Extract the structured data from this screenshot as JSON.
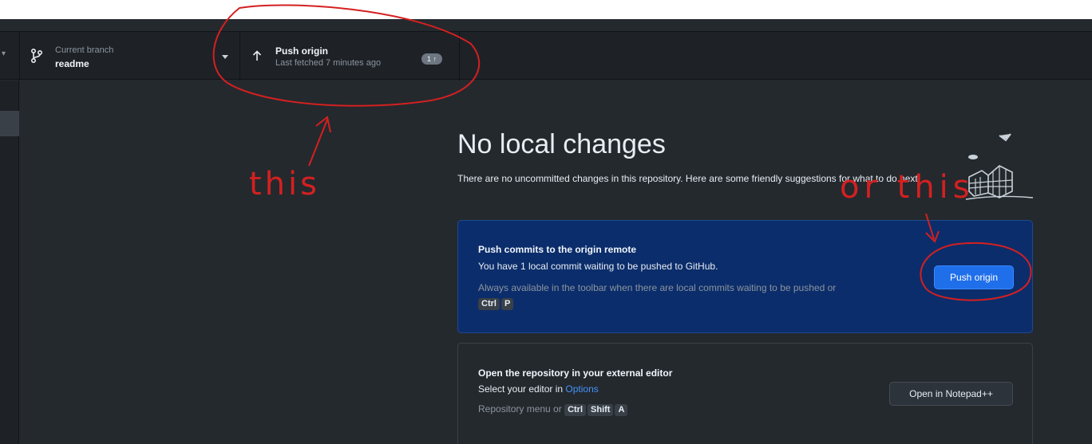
{
  "toolbar": {
    "branch_caption": "Current branch",
    "branch_name": "readme",
    "push_title": "Push origin",
    "push_subtitle": "Last fetched 7 minutes ago",
    "push_badge": "1 ↑"
  },
  "main": {
    "heading": "No local changes",
    "intro": "There are no uncommitted changes in this repository. Here are some friendly suggestions for what to do next.",
    "push_card": {
      "title": "Push commits to the origin remote",
      "description": "You have 1 local commit waiting to be pushed to GitHub.",
      "hint": "Always available in the toolbar when there are local commits waiting to be pushed or",
      "shortcut_keys": [
        "Ctrl",
        "P"
      ],
      "button_label": "Push origin"
    },
    "editor_card": {
      "title": "Open the repository in your external editor",
      "description_prefix": "Select your editor in",
      "description_link": "Options",
      "hint": "Repository menu or",
      "shortcut_keys": [
        "Ctrl",
        "Shift",
        "A"
      ],
      "button_label": "Open in Notepad++"
    }
  },
  "annotations": {
    "label_one": "this",
    "label_two": "or this",
    "color": "#d42020"
  },
  "colors": {
    "app_background": "#24292e",
    "toolbar_background": "#1e2227",
    "accent_blue": "#1f6feb",
    "push_card_background": "#0c2d6b"
  }
}
